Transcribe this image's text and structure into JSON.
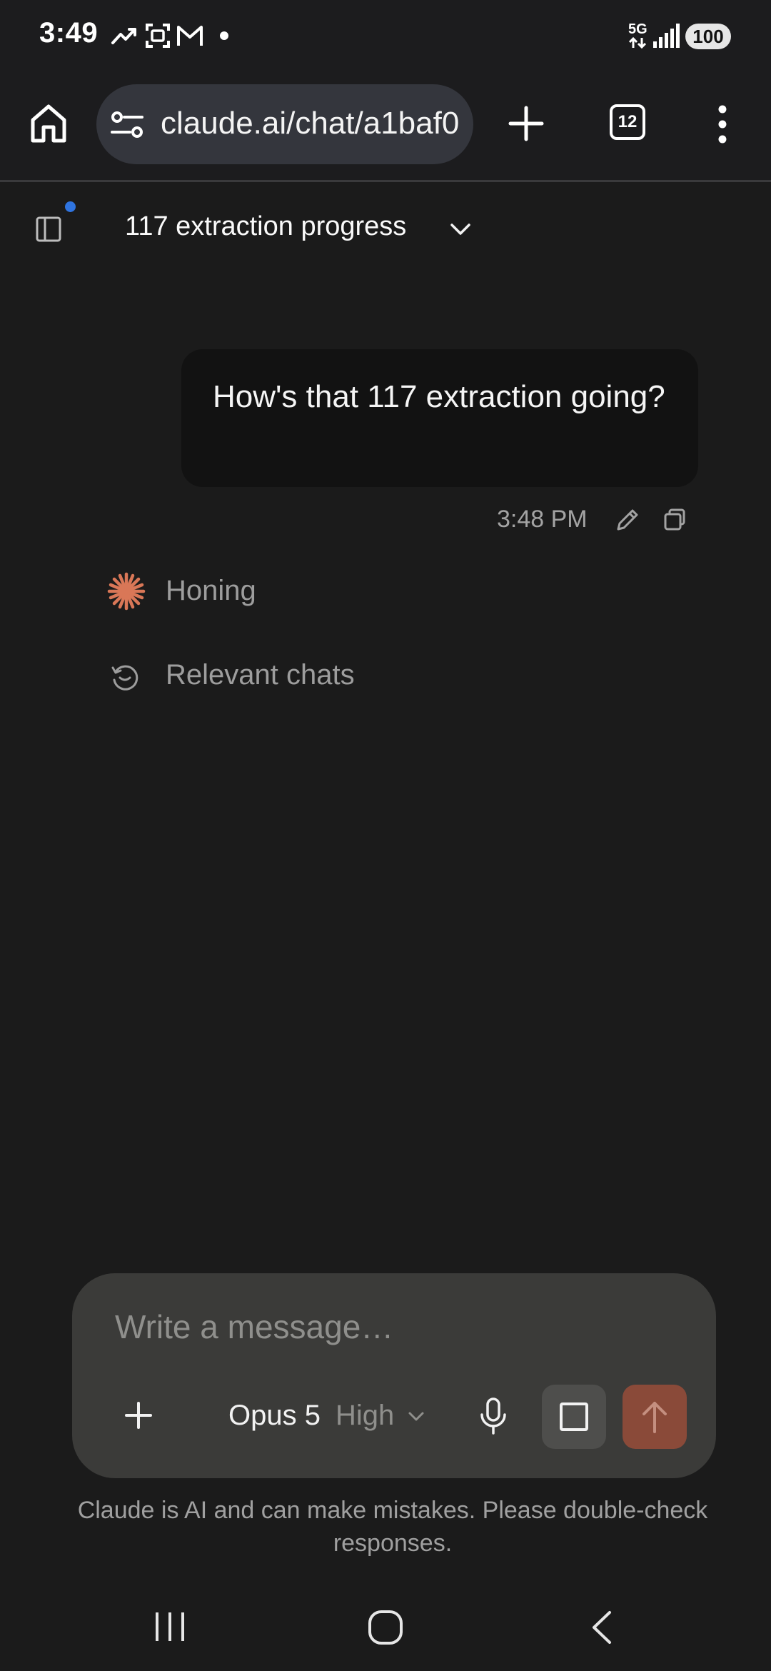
{
  "status_bar": {
    "time": "3:49",
    "network": "5G",
    "battery": "100"
  },
  "browser": {
    "url": "claude.ai/chat/a1baf0",
    "tabs_count": "12"
  },
  "chat": {
    "title": "117 extraction progress",
    "user_message": "How's that 117 extraction going?",
    "message_time": "3:48 PM",
    "status_items": [
      {
        "icon": "spark-icon",
        "label": "Honing"
      },
      {
        "icon": "history-icon",
        "label": "Relevant chats"
      }
    ]
  },
  "composer": {
    "placeholder": "Write a message…",
    "model": "Opus 5",
    "effort": "High"
  },
  "disclaimer": "Claude is AI and can make mistakes. Please double-check responses.",
  "colors": {
    "background": "#1b1b1b",
    "accent": "#d97757",
    "send_button": "#8a4a39",
    "notification_dot": "#2f74e0"
  }
}
